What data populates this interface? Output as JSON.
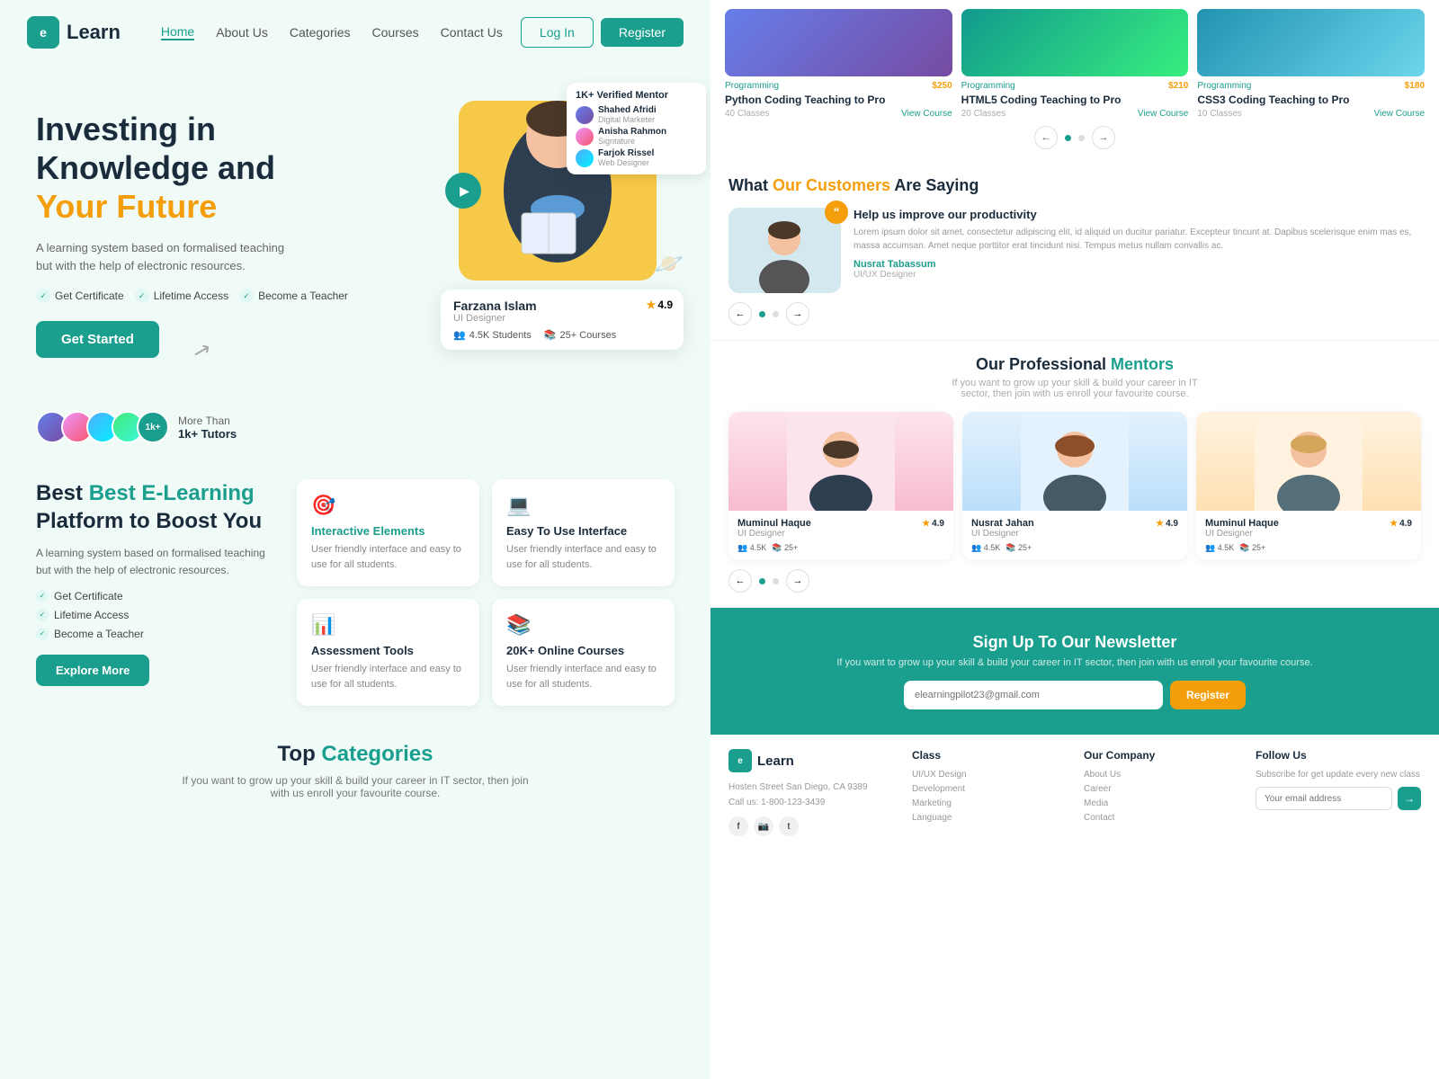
{
  "meta": {
    "title": "eLearn - Online Learning Platform"
  },
  "navbar": {
    "logo_text": "Learn",
    "logo_icon": "e",
    "links": [
      {
        "label": "Home",
        "active": true
      },
      {
        "label": "About Us",
        "active": false
      },
      {
        "label": "Categories",
        "active": false
      },
      {
        "label": "Courses",
        "active": false
      },
      {
        "label": "Contact Us",
        "active": false
      }
    ],
    "login_label": "Log In",
    "register_label": "Register"
  },
  "hero": {
    "title_line1": "Investing in",
    "title_line2": "Knowledge and",
    "title_highlight": "Your Future",
    "description": "A learning system based on formalised teaching but with the help of electronic resources.",
    "features": [
      "Get Certificate",
      "Lifetime Access",
      "Become a Teacher"
    ],
    "cta_label": "Get Started",
    "tutors_count": "1k+",
    "tutors_label": "More Than",
    "tutors_sublabel": "1k+ Tutors"
  },
  "verified_badge": {
    "title": "1K+ Verified Mentor",
    "mentors": [
      {
        "name": "Shahed Afridi",
        "role": "Digital Marketer"
      },
      {
        "name": "Anisha Rahmon",
        "role": "Signtature"
      },
      {
        "name": "Farjok Rissel",
        "role": "Web Designer"
      }
    ]
  },
  "profile_card": {
    "name": "Farzana Islam",
    "role": "UI Designer",
    "rating": "4.9",
    "students": "4.5K Students",
    "courses": "25+ Courses"
  },
  "features_section": {
    "title_line1": "Best E-Learning",
    "title_line2": "Platform to Boost You",
    "description": "A learning system based on formalised teaching but with the help of electronic resources.",
    "list": [
      "Get Certificate",
      "Lifetime Access",
      "Become a Teacher"
    ],
    "cta_label": "Explore More",
    "cards": [
      {
        "icon": "🎯",
        "title": "Interactive Elements",
        "desc": "User friendly interface and easy to use for all students."
      },
      {
        "icon": "💻",
        "title": "Easy To Use Interface",
        "desc": "User friendly interface and easy to use for all students."
      },
      {
        "icon": "📊",
        "title": "Assessment Tools",
        "desc": "User friendly interface and easy to use for all students."
      },
      {
        "icon": "📚",
        "title": "20K+ Online Courses",
        "desc": "User friendly interface and easy to use for all students."
      }
    ]
  },
  "categories_section": {
    "title": "Top ",
    "title_highlight": "Categories",
    "desc": "If you want to grow up your skill & build your career in IT sector, then join with us enroll your favourite course."
  },
  "courses": [
    {
      "tag": "Programming",
      "price": "$250",
      "name": "Python Coding Teaching to Pro",
      "classes": "40 Classes",
      "link": "View Course"
    },
    {
      "tag": "Programming",
      "price": "$210",
      "name": "HTML5 Coding Teaching to Pro",
      "classes": "20 Classes",
      "link": "View Course"
    },
    {
      "tag": "Programming",
      "price": "$180",
      "name": "CSS3 Coding Teaching to Pro",
      "classes": "10 Classes",
      "link": "View Course"
    }
  ],
  "testimonials": {
    "heading": "What ",
    "heading_highlight": "Our Customers",
    "heading_end": " Are Saying",
    "items": [
      {
        "title": "Help us improve our productivity",
        "text": "Lorem ipsum dolor sit amet, consectetur adipiscing elit, id aliquid un ducitur pariatur. Excepteur tincunt at. Dapibus scelerisque enim mas es, massa accumsan. Amet neque porttitor erat tincidunt nisi. Tempus metus nullam convallis ac.",
        "author": "Nusrat Tabassum",
        "role": "UI/UX Designer"
      }
    ]
  },
  "mentors": {
    "heading": "Our Professional ",
    "heading_highlight": "Mentors",
    "subtitle": "If you want to grow up your skill & build your career in IT sector, then join with us enroll your favourite course.",
    "items": [
      {
        "name": "Muminul Haque",
        "title": "UI Designer",
        "rating": "4.9",
        "students": "4.5K",
        "courses": "25+"
      },
      {
        "name": "Nusrat Jahan",
        "title": "UI Designer",
        "rating": "4.9",
        "students": "4.5K",
        "courses": "25+"
      },
      {
        "name": "Muminul Haque",
        "title": "UI Designer",
        "rating": "4.9",
        "students": "4.5K",
        "courses": "25+"
      }
    ]
  },
  "newsletter": {
    "title": "Sign Up To Our Newsletter",
    "desc": "If you want to grow up your skill & build your career in IT sector, then join with us enroll your favourite course.",
    "placeholder": "elearningpilot23@gmail.com",
    "btn_label": "Register"
  },
  "footer": {
    "logo_icon": "e",
    "logo_text": "Learn",
    "address": "Hosten Street San Diego, CA 9389",
    "phone": "Call us: 1-800-123-3439",
    "class_col": {
      "title": "Class",
      "links": [
        "UI/UX Design",
        "Development",
        "Marketing",
        "Language"
      ]
    },
    "company_col": {
      "title": "Our Company",
      "links": [
        "About Us",
        "Career",
        "Media",
        "Contact"
      ]
    },
    "follow_col": {
      "title": "Follow Us",
      "desc": "Subscribe for get update every new class",
      "placeholder": "Your email address"
    }
  }
}
